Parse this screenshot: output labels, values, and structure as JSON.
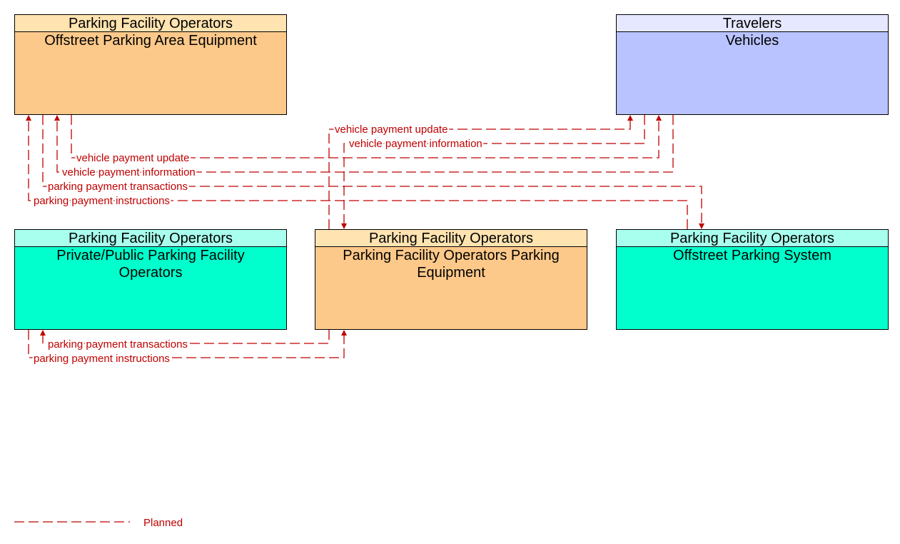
{
  "colors": {
    "flow": "#C00000",
    "orange_header": "#FFE3B0",
    "orange_body": "#FDC98A",
    "blue_header": "#E6E8FF",
    "blue_body": "#B9C3FF",
    "cyan_header": "#A8FFEE",
    "cyan_body": "#00FFCC"
  },
  "nodes": {
    "offstreet_equipment": {
      "group": "Parking Facility Operators",
      "name_lines": [
        "Offstreet Parking Area Equipment"
      ]
    },
    "vehicles": {
      "group": "Travelers",
      "name_lines": [
        "Vehicles"
      ]
    },
    "private_public": {
      "group": "Parking Facility Operators",
      "name_lines": [
        "Private/Public Parking Facility",
        "Operators"
      ]
    },
    "pfo_equipment": {
      "group": "Parking Facility Operators",
      "name_lines": [
        "Parking Facility Operators Parking",
        "Equipment"
      ]
    },
    "offstreet_system": {
      "group": "Parking Facility Operators",
      "name_lines": [
        "Offstreet Parking System"
      ]
    }
  },
  "flows": [
    {
      "label": "vehicle payment update",
      "from": "Parking Facility Operators Parking Equipment",
      "to": "Vehicles",
      "status": "Planned"
    },
    {
      "label": "vehicle payment information",
      "from": "Vehicles",
      "to": "Parking Facility Operators Parking Equipment",
      "status": "Planned"
    },
    {
      "label": "vehicle payment update",
      "from": "Offstreet Parking Area Equipment",
      "to": "Vehicles",
      "status": "Planned"
    },
    {
      "label": "vehicle payment information",
      "from": "Vehicles",
      "to": "Offstreet Parking Area Equipment",
      "status": "Planned"
    },
    {
      "label": "parking payment transactions",
      "from": "Offstreet Parking Area Equipment",
      "to": "Offstreet Parking System",
      "status": "Planned"
    },
    {
      "label": "parking payment instructions",
      "from": "Offstreet Parking System",
      "to": "Offstreet Parking Area Equipment",
      "status": "Planned"
    },
    {
      "label": "parking payment transactions",
      "from": "Parking Facility Operators Parking Equipment",
      "to": "Private/Public Parking Facility Operators",
      "status": "Planned"
    },
    {
      "label": "parking payment instructions",
      "from": "Private/Public Parking Facility Operators",
      "to": "Parking Facility Operators Parking Equipment",
      "status": "Planned"
    }
  ],
  "legend": {
    "planned_label": "Planned"
  }
}
